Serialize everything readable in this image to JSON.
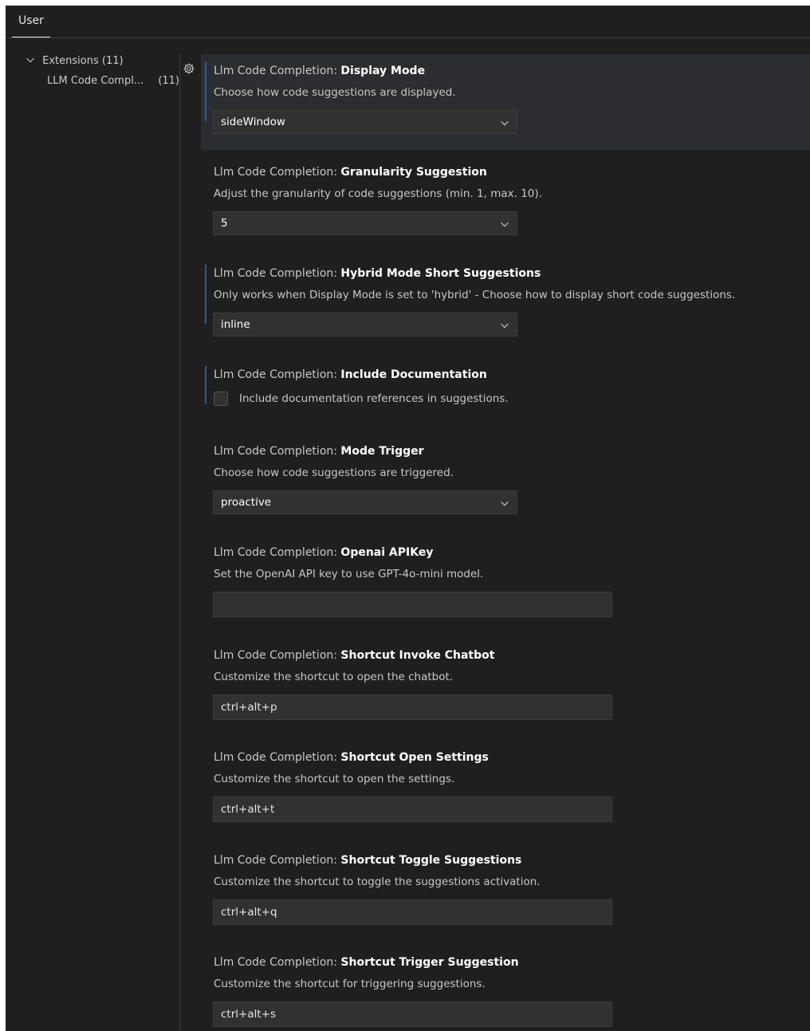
{
  "tabs": [
    {
      "label": "User"
    }
  ],
  "toc": {
    "extensions": {
      "label": "Extensions",
      "count": "(11)"
    },
    "llm": {
      "label": "LLM Code Compl...",
      "count": "(11)"
    }
  },
  "settings": [
    {
      "category": "Llm Code Completion: ",
      "key": "Display Mode",
      "description": "Choose how code suggestions are displayed.",
      "control": "select",
      "value": "sideWindow"
    },
    {
      "category": "Llm Code Completion: ",
      "key": "Granularity Suggestion",
      "description": "Adjust the granularity of code suggestions (min. 1, max. 10).",
      "control": "select",
      "value": "5"
    },
    {
      "category": "Llm Code Completion: ",
      "key": "Hybrid Mode Short Suggestions",
      "description": "Only works when Display Mode is set to 'hybrid' - Choose how to display short code suggestions.",
      "control": "select",
      "value": "inline"
    },
    {
      "category": "Llm Code Completion: ",
      "key": "Include Documentation",
      "description": "Include documentation references in suggestions.",
      "control": "checkbox",
      "checked": false
    },
    {
      "category": "Llm Code Completion: ",
      "key": "Mode Trigger",
      "description": "Choose how code suggestions are triggered.",
      "control": "select",
      "value": "proactive"
    },
    {
      "category": "Llm Code Completion: ",
      "key": "Openai APIKey",
      "description": "Set the OpenAI API key to use GPT-4o-mini model.",
      "control": "text",
      "value": ""
    },
    {
      "category": "Llm Code Completion: ",
      "key": "Shortcut Invoke Chatbot",
      "description": "Customize the shortcut to open the chatbot.",
      "control": "text",
      "value": "ctrl+alt+p"
    },
    {
      "category": "Llm Code Completion: ",
      "key": "Shortcut Open Settings",
      "description": "Customize the shortcut to open the settings.",
      "control": "text",
      "value": "ctrl+alt+t"
    },
    {
      "category": "Llm Code Completion: ",
      "key": "Shortcut Toggle Suggestions",
      "description": "Customize the shortcut to toggle the suggestions activation.",
      "control": "text",
      "value": "ctrl+alt+q"
    },
    {
      "category": "Llm Code Completion: ",
      "key": "Shortcut Trigger Suggestion",
      "description": "Customize the shortcut for triggering suggestions.",
      "control": "text",
      "value": "ctrl+alt+s"
    }
  ],
  "icons": {
    "expand": "chevron-down-icon",
    "gear": "gear-icon",
    "dropdown": "chevron-down-icon"
  },
  "colors": {
    "background": "#1f1f1f",
    "focused_row": "#2b2d30",
    "input": "#313131",
    "modified_indicator": "#1f5fa3"
  }
}
